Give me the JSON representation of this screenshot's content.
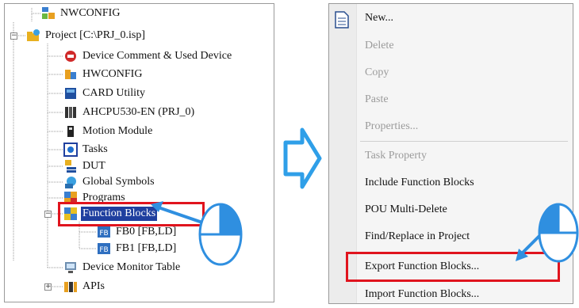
{
  "tree": {
    "items": [
      {
        "label": "NWCONFIG"
      },
      {
        "label": "Project [C:\\PRJ_0.isp]"
      },
      {
        "label": "Device Comment & Used Device"
      },
      {
        "label": "HWCONFIG"
      },
      {
        "label": "CARD Utility"
      },
      {
        "label": "AHCPU530-EN  (PRJ_0)"
      },
      {
        "label": "Motion Module"
      },
      {
        "label": "Tasks"
      },
      {
        "label": "DUT"
      },
      {
        "label": "Global Symbols"
      },
      {
        "label": "Programs"
      },
      {
        "label": "Function Blocks"
      },
      {
        "label": "FB0 [FB,LD]"
      },
      {
        "label": "FB1 [FB,LD]"
      },
      {
        "label": "Device Monitor Table"
      },
      {
        "label": "APIs"
      }
    ],
    "expander_expanded": "−",
    "expander_collapsed": "+"
  },
  "menu": {
    "items": [
      {
        "label": "New...",
        "enabled": true
      },
      {
        "label": "Delete",
        "enabled": false
      },
      {
        "label": "Copy",
        "enabled": false
      },
      {
        "label": "Paste",
        "enabled": false
      },
      {
        "label": "Properties...",
        "enabled": false
      },
      {
        "label": "Task Property",
        "enabled": false
      },
      {
        "label": "Include Function Blocks",
        "enabled": true
      },
      {
        "label": "POU Multi-Delete",
        "enabled": true
      },
      {
        "label": "Find/Replace in Project",
        "enabled": true
      },
      {
        "label": "Export Function Blocks...",
        "enabled": true
      },
      {
        "label": "Import Function Blocks...",
        "enabled": true
      }
    ]
  },
  "colors": {
    "highlight_border": "#e0141e",
    "selection": "#1f3f9f",
    "arrow": "#2f9fe8",
    "pointer": "#2f8fe0"
  }
}
